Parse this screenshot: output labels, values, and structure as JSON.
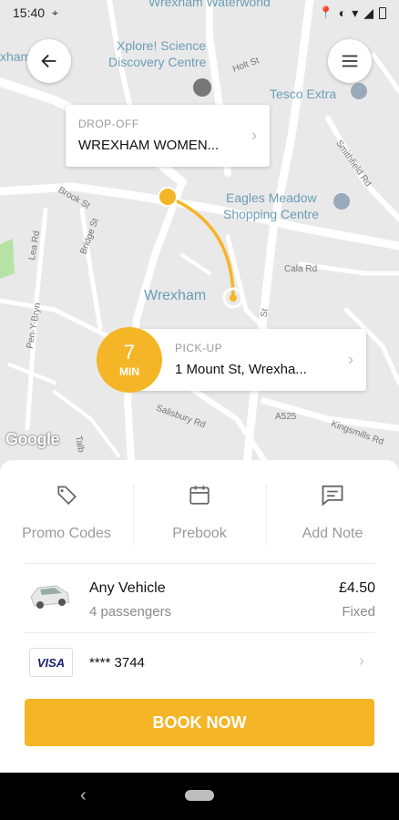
{
  "status": {
    "time": "15:40"
  },
  "map": {
    "labels": {
      "waterworld": "Wrexham Waterworld",
      "xplore": "Xplore! Science",
      "xplore2": "Discovery Centre",
      "tesco": "Tesco Extra",
      "eagles": "Eagles Meadow",
      "eagles2": "Shopping Centre",
      "wrexham": "Wrexham",
      "holt": "Holt St",
      "brook": "Brook St",
      "bridge": "Bridge St",
      "lea": "Lea Rd",
      "pen": "Pen-Y-Bryn",
      "smithfield": "Smithfield Rd",
      "cala": "Cala Rd",
      "salisbury": "Salisbury Rd",
      "a525": "A525",
      "kings": "Kingsmills Rd",
      "tal": "Talb",
      "st": "St",
      "lleft": "xham"
    },
    "google": "Google"
  },
  "dropoff": {
    "label": "DROP-OFF",
    "value": "WREXHAM WOMEN..."
  },
  "pickup": {
    "label": "PICK-UP",
    "value": "1 Mount St, Wrexha..."
  },
  "eta": {
    "value": "7",
    "unit": "MIN"
  },
  "actions": [
    {
      "label": "Promo Codes"
    },
    {
      "label": "Prebook"
    },
    {
      "label": "Add Note"
    }
  ],
  "vehicle": {
    "name": "Any Vehicle",
    "passengers": "4 passengers",
    "price": "£4.50",
    "price_type": "Fixed"
  },
  "payment": {
    "brand": "VISA",
    "card": "**** 3744"
  },
  "book_button": "BOOK NOW",
  "colors": {
    "accent": "#f4b526"
  }
}
